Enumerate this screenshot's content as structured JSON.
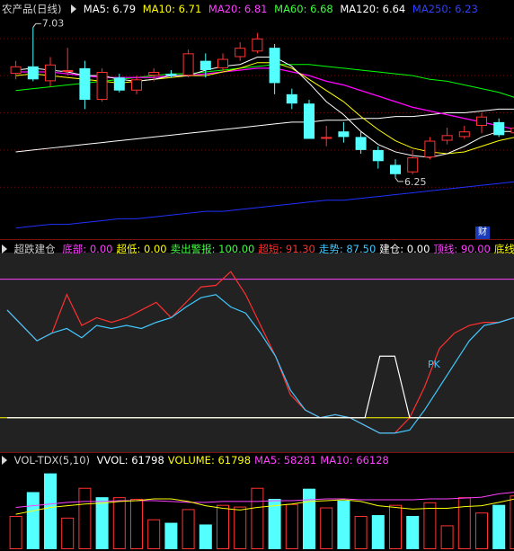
{
  "price_panel": {
    "title": "农产品(日线)",
    "ma5": "MA5: 6.79",
    "ma10": "MA10: 6.71",
    "ma20": "MA20: 6.81",
    "ma60": "MA60: 6.68",
    "ma120": "MA120: 6.64",
    "ma250": "MA250: 6.23",
    "high_label": "7.03",
    "low_label": "6.25",
    "cai_label": "财",
    "colors": {
      "up": "#ff3232",
      "down": "#54ffff",
      "ma5": "#ffffff",
      "ma10": "#ffff00",
      "ma20": "#ff00ff",
      "ma60": "#00ff00",
      "ma120": "#ffffff",
      "ma250": "#2030ff"
    }
  },
  "indicator_panel": {
    "title": "超跌建仓",
    "items": [
      {
        "text": "底部: 0.00",
        "color": "#ff40ff"
      },
      {
        "text": "超低: 0.00",
        "color": "#ffff00"
      },
      {
        "text": "卖出警报: 100.00",
        "color": "#40ff40"
      },
      {
        "text": "超短: 91.30",
        "color": "#ff3030"
      },
      {
        "text": "走势: 87.50",
        "color": "#40c8ff"
      },
      {
        "text": "建仓: 0.00",
        "color": "#ffffff"
      },
      {
        "text": "顶线: 90.00",
        "color": "#ff40ff"
      },
      {
        "text": "底线:",
        "color": "#ffff00"
      }
    ],
    "pk_label": "PK"
  },
  "volume_panel": {
    "title": "VOL-TDX(5,10)",
    "items": [
      {
        "text": "VVOL: 61798",
        "color": "#ffffff"
      },
      {
        "text": "VOLUME: 61798",
        "color": "#ffff00"
      },
      {
        "text": "MA5: 58281",
        "color": "#ff40ff"
      },
      {
        "text": "MA10: 66128",
        "color": "#ff40ff"
      }
    ]
  },
  "chart_data": [
    {
      "type": "candlestick",
      "title": "农产品(日线)",
      "candles": [
        {
          "o": 6.81,
          "c": 6.85,
          "h": 6.88,
          "l": 6.78
        },
        {
          "o": 6.85,
          "c": 6.78,
          "h": 7.06,
          "l": 6.77
        },
        {
          "o": 6.77,
          "c": 6.86,
          "h": 6.9,
          "l": 6.74
        },
        {
          "o": 6.83,
          "c": 6.83,
          "h": 6.95,
          "l": 6.8
        },
        {
          "o": 6.84,
          "c": 6.67,
          "h": 6.88,
          "l": 6.62
        },
        {
          "o": 6.67,
          "c": 6.82,
          "h": 6.84,
          "l": 6.66
        },
        {
          "o": 6.79,
          "c": 6.72,
          "h": 6.81,
          "l": 6.71
        },
        {
          "o": 6.72,
          "c": 6.78,
          "h": 6.8,
          "l": 6.7
        },
        {
          "o": 6.8,
          "c": 6.82,
          "h": 6.84,
          "l": 6.77
        },
        {
          "o": 6.81,
          "c": 6.8,
          "h": 6.83,
          "l": 6.79
        },
        {
          "o": 6.8,
          "c": 6.92,
          "h": 6.94,
          "l": 6.79
        },
        {
          "o": 6.88,
          "c": 6.83,
          "h": 6.92,
          "l": 6.79
        },
        {
          "o": 6.84,
          "c": 6.89,
          "h": 6.92,
          "l": 6.82
        },
        {
          "o": 6.9,
          "c": 6.95,
          "h": 6.98,
          "l": 6.88
        },
        {
          "o": 6.93,
          "c": 7.0,
          "h": 7.03,
          "l": 6.92
        },
        {
          "o": 6.95,
          "c": 6.76,
          "h": 6.97,
          "l": 6.7
        },
        {
          "o": 6.7,
          "c": 6.65,
          "h": 6.73,
          "l": 6.62
        },
        {
          "o": 6.65,
          "c": 6.46,
          "h": 6.67,
          "l": 6.46
        },
        {
          "o": 6.46,
          "c": 6.47,
          "h": 6.53,
          "l": 6.42
        },
        {
          "o": 6.5,
          "c": 6.47,
          "h": 6.55,
          "l": 6.44
        },
        {
          "o": 6.47,
          "c": 6.4,
          "h": 6.5,
          "l": 6.38
        },
        {
          "o": 6.4,
          "c": 6.34,
          "h": 6.42,
          "l": 6.3
        },
        {
          "o": 6.32,
          "c": 6.27,
          "h": 6.35,
          "l": 6.25
        },
        {
          "o": 6.28,
          "c": 6.36,
          "h": 6.4,
          "l": 6.27
        },
        {
          "o": 6.36,
          "c": 6.45,
          "h": 6.47,
          "l": 6.35
        },
        {
          "o": 6.45,
          "c": 6.48,
          "h": 6.52,
          "l": 6.43
        },
        {
          "o": 6.47,
          "c": 6.5,
          "h": 6.53,
          "l": 6.46
        },
        {
          "o": 6.53,
          "c": 6.58,
          "h": 6.6,
          "l": 6.49
        },
        {
          "o": 6.55,
          "c": 6.48,
          "h": 6.57,
          "l": 6.47
        },
        {
          "o": 6.49,
          "c": 6.52,
          "h": 6.54,
          "l": 6.45
        }
      ],
      "ma5": [
        6.83,
        6.84,
        6.83,
        6.82,
        6.8,
        6.8,
        6.78,
        6.77,
        6.78,
        6.8,
        6.8,
        6.83,
        6.85,
        6.86,
        6.9,
        6.9,
        6.85,
        6.76,
        6.66,
        6.59,
        6.5,
        6.43,
        6.39,
        6.37,
        6.36,
        6.38,
        6.42,
        6.47,
        6.5,
        6.5
      ],
      "ma10": [
        6.8,
        6.81,
        6.8,
        6.79,
        6.78,
        6.77,
        6.76,
        6.77,
        6.78,
        6.79,
        6.8,
        6.8,
        6.82,
        6.84,
        6.87,
        6.87,
        6.84,
        6.78,
        6.72,
        6.66,
        6.58,
        6.51,
        6.45,
        6.41,
        6.39,
        6.38,
        6.39,
        6.42,
        6.45,
        6.47
      ],
      "ma20": [
        6.82,
        6.82,
        6.82,
        6.81,
        6.8,
        6.79,
        6.79,
        6.79,
        6.79,
        6.8,
        6.8,
        6.81,
        6.82,
        6.83,
        6.84,
        6.84,
        6.82,
        6.8,
        6.77,
        6.75,
        6.72,
        6.69,
        6.66,
        6.63,
        6.61,
        6.59,
        6.57,
        6.55,
        6.53,
        6.51
      ],
      "ma60": [
        6.72,
        6.73,
        6.74,
        6.75,
        6.76,
        6.77,
        6.78,
        6.79,
        6.8,
        6.81,
        6.81,
        6.82,
        6.83,
        6.84,
        6.85,
        6.86,
        6.86,
        6.86,
        6.85,
        6.84,
        6.83,
        6.82,
        6.81,
        6.8,
        6.78,
        6.77,
        6.75,
        6.73,
        6.71,
        6.68
      ],
      "ma120": [
        6.39,
        6.4,
        6.41,
        6.42,
        6.43,
        6.44,
        6.45,
        6.46,
        6.47,
        6.48,
        6.49,
        6.5,
        6.51,
        6.52,
        6.53,
        6.54,
        6.55,
        6.55,
        6.56,
        6.56,
        6.57,
        6.57,
        6.58,
        6.58,
        6.59,
        6.6,
        6.6,
        6.61,
        6.62,
        6.62
      ],
      "ma250": [
        5.98,
        5.99,
        6.0,
        6.0,
        6.01,
        6.02,
        6.03,
        6.03,
        6.04,
        6.05,
        6.06,
        6.07,
        6.07,
        6.08,
        6.09,
        6.1,
        6.11,
        6.12,
        6.13,
        6.13,
        6.14,
        6.15,
        6.16,
        6.17,
        6.18,
        6.19,
        6.2,
        6.21,
        6.22,
        6.23
      ],
      "high": 7.03,
      "low": 6.25,
      "ylim": [
        5.94,
        7.12
      ]
    },
    {
      "type": "line",
      "title": "超跌建仓",
      "ylim": [
        -20,
        105
      ],
      "top_line": 90,
      "bottom_line": 0,
      "series": [
        {
          "name": "超短",
          "color": "#ff3030",
          "values": [
            70,
            60,
            50,
            55,
            80,
            60,
            65,
            62,
            65,
            70,
            75,
            65,
            75,
            85,
            86,
            95,
            80,
            60,
            40,
            15,
            5,
            0,
            2,
            0,
            -5,
            -10,
            -10,
            0,
            20,
            45,
            55,
            60,
            62,
            62,
            65
          ]
        },
        {
          "name": "走势",
          "color": "#40c8ff",
          "values": [
            70,
            60,
            50,
            55,
            58,
            52,
            60,
            58,
            60,
            58,
            62,
            65,
            72,
            78,
            80,
            72,
            68,
            55,
            40,
            18,
            5,
            0,
            2,
            0,
            -5,
            -10,
            -10,
            -8,
            5,
            20,
            35,
            50,
            60,
            62,
            65
          ]
        },
        {
          "name": "建仓",
          "color": "#ffffff",
          "values": [
            0,
            0,
            0,
            0,
            0,
            0,
            0,
            0,
            0,
            0,
            0,
            0,
            0,
            0,
            0,
            0,
            0,
            0,
            0,
            0,
            0,
            0,
            0,
            0,
            0,
            40,
            40,
            0,
            0,
            0,
            0,
            0,
            0,
            0,
            0
          ]
        }
      ]
    },
    {
      "type": "bar",
      "title": "VOL-TDX(5,10)",
      "ylim": [
        0,
        95000
      ],
      "bars": [
        {
          "v": 38000,
          "up": true
        },
        {
          "v": 66000,
          "up": false
        },
        {
          "v": 88000,
          "up": false
        },
        {
          "v": 36000,
          "up": true
        },
        {
          "v": 71000,
          "up": true
        },
        {
          "v": 60000,
          "up": false
        },
        {
          "v": 60000,
          "up": true
        },
        {
          "v": 58000,
          "up": true
        },
        {
          "v": 34000,
          "up": true
        },
        {
          "v": 30000,
          "up": false
        },
        {
          "v": 46000,
          "up": true
        },
        {
          "v": 28000,
          "up": false
        },
        {
          "v": 51000,
          "up": true
        },
        {
          "v": 49000,
          "up": true
        },
        {
          "v": 71000,
          "up": true
        },
        {
          "v": 58000,
          "up": false
        },
        {
          "v": 52000,
          "up": true
        },
        {
          "v": 70000,
          "up": false
        },
        {
          "v": 48000,
          "up": true
        },
        {
          "v": 56000,
          "up": false
        },
        {
          "v": 38000,
          "up": true
        },
        {
          "v": 39000,
          "up": false
        },
        {
          "v": 51000,
          "up": true
        },
        {
          "v": 38000,
          "up": false
        },
        {
          "v": 54000,
          "up": true
        },
        {
          "v": 27000,
          "up": true
        },
        {
          "v": 60000,
          "up": true
        },
        {
          "v": 42000,
          "up": true
        },
        {
          "v": 51000,
          "up": false
        },
        {
          "v": 62000,
          "up": true
        }
      ],
      "ma5": [
        40000,
        44000,
        48000,
        50000,
        52000,
        53000,
        55000,
        56000,
        58000,
        58000,
        55000,
        50000,
        47000,
        45000,
        48000,
        50000,
        52000,
        55000,
        56000,
        57000,
        55000,
        50000,
        48000,
        46000,
        47000,
        47000,
        49000,
        50000,
        54000,
        58281
      ],
      "ma10": [
        48000,
        50000,
        52000,
        54000,
        55000,
        55000,
        56000,
        56000,
        56000,
        55000,
        54000,
        54000,
        55000,
        55000,
        55000,
        56000,
        56000,
        57000,
        58000,
        58000,
        57000,
        57000,
        57000,
        57000,
        58000,
        58000,
        59000,
        60000,
        64000,
        66128
      ]
    }
  ]
}
